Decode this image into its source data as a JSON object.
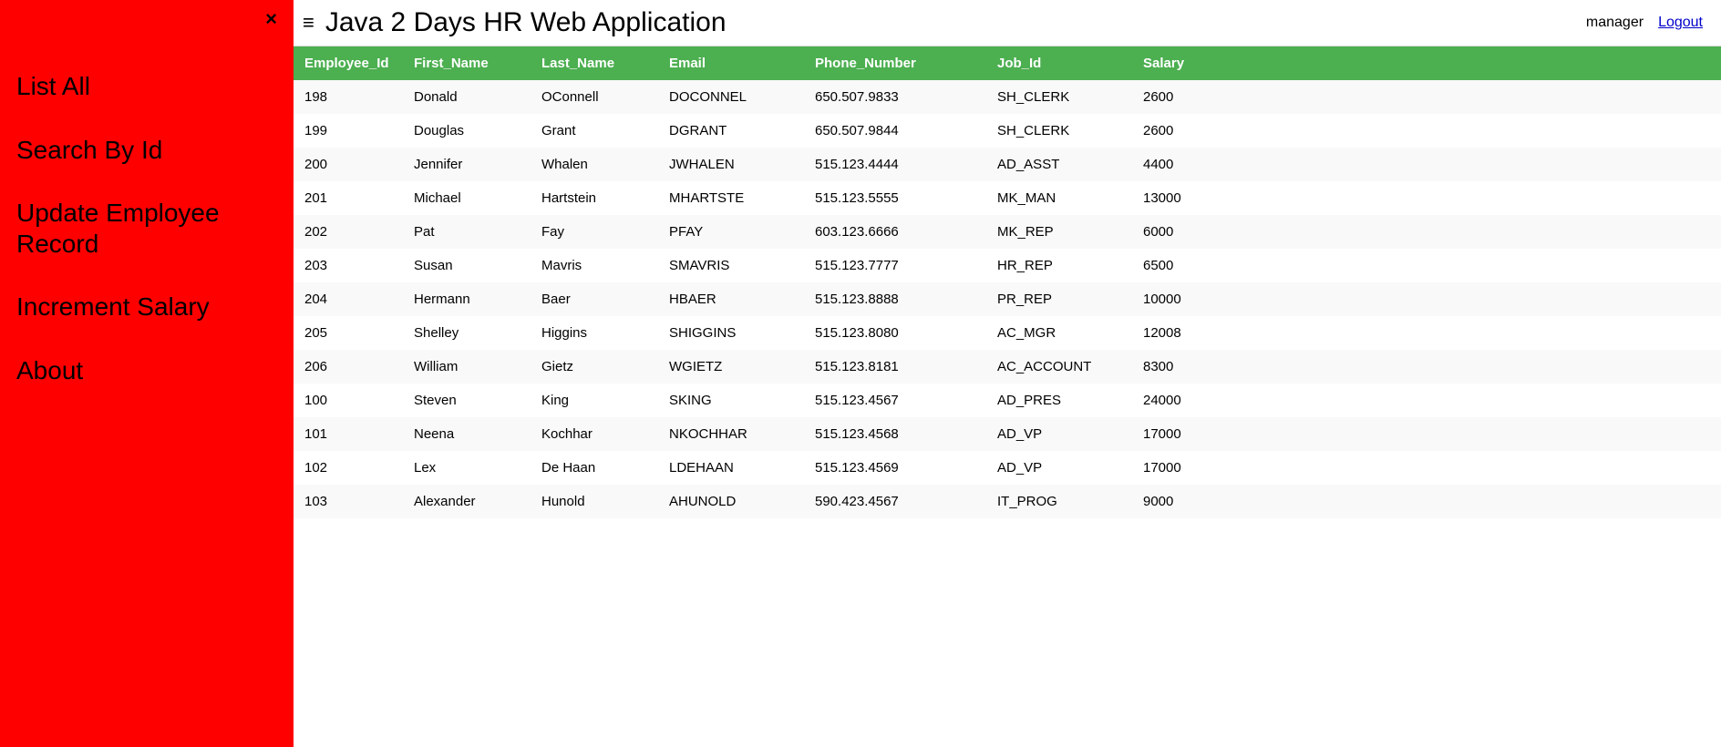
{
  "sidebar": {
    "close_label": "×",
    "nav_items": [
      {
        "id": "list-all",
        "label": "List All"
      },
      {
        "id": "search-by-id",
        "label": "Search By Id"
      },
      {
        "id": "update-employee-record",
        "label": "Update Employee Record"
      },
      {
        "id": "increment-salary",
        "label": "Increment Salary"
      },
      {
        "id": "about",
        "label": "About"
      }
    ]
  },
  "header": {
    "hamburger": "≡",
    "title": "Java 2 Days HR Web Application",
    "user_label": "manager",
    "logout_label": "Logout"
  },
  "table": {
    "columns": [
      "Employee_Id",
      "First_Name",
      "Last_Name",
      "Email",
      "Phone_Number",
      "Job_Id",
      "Salary"
    ],
    "rows": [
      [
        "198",
        "Donald",
        "OConnell",
        "DOCONNEL",
        "650.507.9833",
        "SH_CLERK",
        "2600"
      ],
      [
        "199",
        "Douglas",
        "Grant",
        "DGRANT",
        "650.507.9844",
        "SH_CLERK",
        "2600"
      ],
      [
        "200",
        "Jennifer",
        "Whalen",
        "JWHALEN",
        "515.123.4444",
        "AD_ASST",
        "4400"
      ],
      [
        "201",
        "Michael",
        "Hartstein",
        "MHARTSTE",
        "515.123.5555",
        "MK_MAN",
        "13000"
      ],
      [
        "202",
        "Pat",
        "Fay",
        "PFAY",
        "603.123.6666",
        "MK_REP",
        "6000"
      ],
      [
        "203",
        "Susan",
        "Mavris",
        "SMAVRIS",
        "515.123.7777",
        "HR_REP",
        "6500"
      ],
      [
        "204",
        "Hermann",
        "Baer",
        "HBAER",
        "515.123.8888",
        "PR_REP",
        "10000"
      ],
      [
        "205",
        "Shelley",
        "Higgins",
        "SHIGGINS",
        "515.123.8080",
        "AC_MGR",
        "12008"
      ],
      [
        "206",
        "William",
        "Gietz",
        "WGIETZ",
        "515.123.8181",
        "AC_ACCOUNT",
        "8300"
      ],
      [
        "100",
        "Steven",
        "King",
        "SKING",
        "515.123.4567",
        "AD_PRES",
        "24000"
      ],
      [
        "101",
        "Neena",
        "Kochhar",
        "NKOCHHAR",
        "515.123.4568",
        "AD_VP",
        "17000"
      ],
      [
        "102",
        "Lex",
        "De Haan",
        "LDEHAAN",
        "515.123.4569",
        "AD_VP",
        "17000"
      ],
      [
        "103",
        "Alexander",
        "Hunold",
        "AHUNOLD",
        "590.423.4567",
        "IT_PROG",
        "9000"
      ]
    ]
  }
}
